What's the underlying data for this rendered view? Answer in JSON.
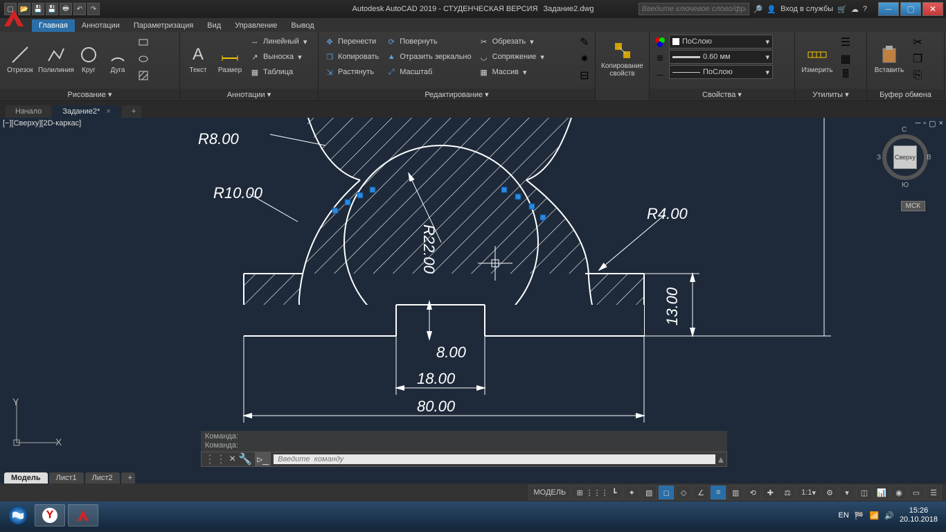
{
  "title": {
    "app": "Autodesk AutoCAD 2019 - СТУДЕНЧЕСКАЯ ВЕРСИЯ",
    "file": "Задание2.dwg"
  },
  "search": {
    "placeholder": "Введите ключевое слово/фразу"
  },
  "signin": "Вход в службы",
  "ribbon_tabs": [
    "Главная",
    "Аннотации",
    "Параметризация",
    "Вид",
    "Управление",
    "Вывод"
  ],
  "panels": {
    "draw": {
      "title": "Рисование ▾",
      "line": "Отрезок",
      "pline": "Полилиния",
      "circle": "Круг",
      "arc": "Дуга"
    },
    "annot": {
      "title": "Аннотации ▾",
      "text": "Текст",
      "dim": "Размер",
      "linear": "Линейный",
      "leader": "Выноска",
      "table": "Таблица"
    },
    "edit": {
      "title": "Редактирование ▾",
      "move": "Перенести",
      "copy": "Копировать",
      "stretch": "Растянуть",
      "rotate": "Повернуть",
      "mirror": "Отразить зеркально",
      "scale": "Масштаб",
      "trim": "Обрезать",
      "fillet": "Сопряжение",
      "array": "Массив"
    },
    "copyprop": "Копирование свойств",
    "props": {
      "title": "Свойства ▾",
      "layer": "ПоСлою",
      "lw": "0.60 мм",
      "lt": "ПоСлою"
    },
    "util": {
      "title": "Утилиты ▾",
      "measure": "Измерить"
    },
    "clip": {
      "title": "Буфер обмена",
      "paste": "Вставить"
    }
  },
  "doctabs": {
    "home": "Начало",
    "active": "Задание2*"
  },
  "view_label": "[−][Сверху][2D-каркас]",
  "viewcube": {
    "center": "Сверху",
    "n": "С",
    "s": "Ю",
    "e": "В",
    "w": "З"
  },
  "wcs": "МСК",
  "cmd": {
    "hist1": "Команда:",
    "hist2": "Команда:",
    "placeholder": "Введите  команду"
  },
  "layout_tabs": {
    "model": "Модель",
    "l1": "Лист1",
    "l2": "Лист2"
  },
  "status": {
    "model": "МОДЕЛЬ",
    "scale": "1:1"
  },
  "dimensions": {
    "r8": "R8.00",
    "r10": "R10.00",
    "r22": "R22.00",
    "r4": "R4.00",
    "d13": "13.00",
    "d8": "8.00",
    "d18": "18.00",
    "d80": "80.00"
  },
  "ucs": {
    "x": "X",
    "y": "Y"
  },
  "tray": {
    "lang": "EN",
    "time": "15:26",
    "date": "20.10.2018"
  }
}
